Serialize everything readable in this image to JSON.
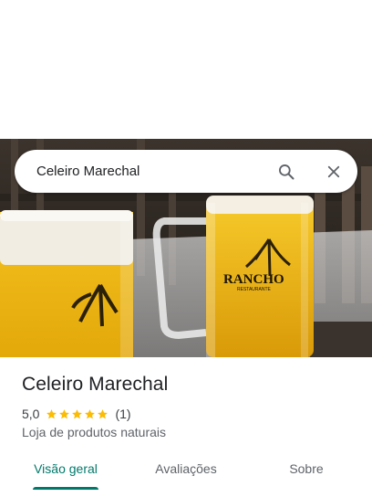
{
  "search": {
    "query": "Celeiro Marechal"
  },
  "place": {
    "name": "Celeiro Marechal",
    "rating": "5,0",
    "rating_value": 5,
    "review_count": "(1)",
    "category": "Loja de produtos naturais"
  },
  "photo": {
    "mug_brand": "RANCHO",
    "mug_sub": "RESTAURANTE"
  },
  "tabs": [
    {
      "label": "Visão geral",
      "active": true
    },
    {
      "label": "Avaliações",
      "active": false
    },
    {
      "label": "Sobre",
      "active": false
    }
  ],
  "colors": {
    "accent": "#00796b",
    "star": "#fbbc04"
  },
  "icons": {
    "search": "search-icon",
    "close": "close-icon",
    "star": "star-icon"
  }
}
